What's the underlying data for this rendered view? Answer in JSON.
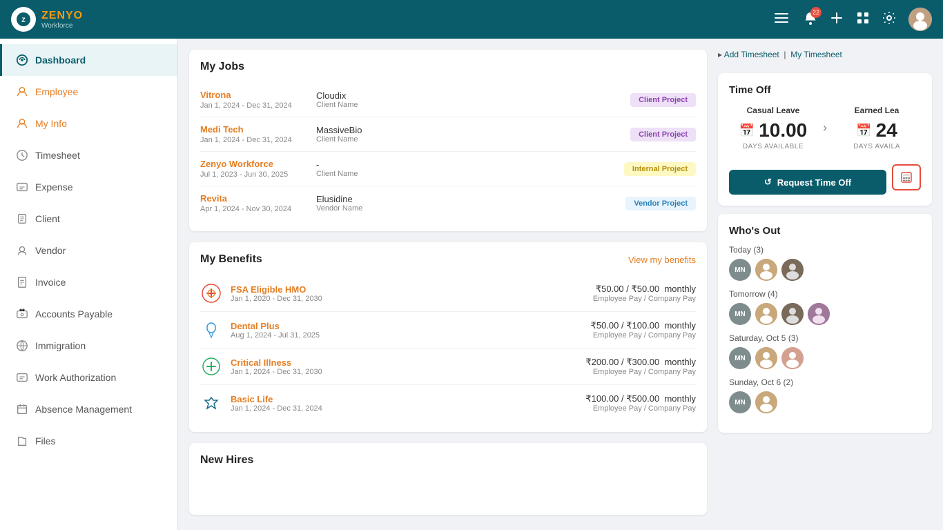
{
  "header": {
    "logo_text": "ZENYO",
    "logo_sub": "Workforce",
    "notification_count": "22",
    "actions": [
      "notification",
      "add",
      "apps",
      "settings",
      "avatar"
    ]
  },
  "sidebar": {
    "items": [
      {
        "id": "dashboard",
        "label": "Dashboard",
        "active": true
      },
      {
        "id": "employee",
        "label": "Employee",
        "active": false,
        "orange": true
      },
      {
        "id": "myinfo",
        "label": "My Info",
        "active": false,
        "orange": true
      },
      {
        "id": "timesheet",
        "label": "Timesheet",
        "active": false
      },
      {
        "id": "expense",
        "label": "Expense",
        "active": false
      },
      {
        "id": "client",
        "label": "Client",
        "active": false
      },
      {
        "id": "vendor",
        "label": "Vendor",
        "active": false
      },
      {
        "id": "invoice",
        "label": "Invoice",
        "active": false
      },
      {
        "id": "accounts-payable",
        "label": "Accounts Payable",
        "active": false
      },
      {
        "id": "immigration",
        "label": "Immigration",
        "active": false
      },
      {
        "id": "work-authorization",
        "label": "Work Authorization",
        "active": false
      },
      {
        "id": "absence-management",
        "label": "Absence Management",
        "active": false
      },
      {
        "id": "files",
        "label": "Files",
        "active": false
      }
    ]
  },
  "my_jobs": {
    "title": "My Jobs",
    "rows": [
      {
        "name": "Vitrona",
        "dates": "Jan 1, 2024 - Dec 31, 2024",
        "client": "Cloudix",
        "client_label": "Client Name",
        "badge": "Client Project",
        "badge_type": "client"
      },
      {
        "name": "Medi Tech",
        "dates": "Jan 1, 2024 - Dec 31, 2024",
        "client": "MassiveBio",
        "client_label": "Client Name",
        "badge": "Client Project",
        "badge_type": "client"
      },
      {
        "name": "Zenyo Workforce",
        "dates": "Jul 1, 2023 - Jun 30, 2025",
        "client": "-",
        "client_label": "Client Name",
        "badge": "Internal Project",
        "badge_type": "internal"
      },
      {
        "name": "Revita",
        "dates": "Apr 1, 2024 - Nov 30, 2024",
        "client": "Elusidine",
        "client_label": "Vendor Name",
        "badge": "Vendor Project",
        "badge_type": "vendor"
      }
    ]
  },
  "my_benefits": {
    "title": "My Benefits",
    "view_link": "View my benefits",
    "rows": [
      {
        "name": "FSA Eligible HMO",
        "dates": "Jan 1, 2020 - Dec 31, 2030",
        "amount": "₹50.00 / ₹50.00  monthly",
        "pay_label": "Employee Pay / Company Pay",
        "icon": "❤️"
      },
      {
        "name": "Dental Plus",
        "dates": "Aug 1, 2024 - Jul 31, 2025",
        "amount": "₹50.00 / ₹100.00  monthly",
        "pay_label": "Employee Pay / Company Pay",
        "icon": "🦷"
      },
      {
        "name": "Critical Illness",
        "dates": "Jan 1, 2024 - Dec 31, 2030",
        "amount": "₹200.00 / ₹300.00  monthly",
        "pay_label": "Employee Pay / Company Pay",
        "icon": "💚"
      },
      {
        "name": "Basic Life",
        "dates": "Jan 1, 2024 - Dec 31, 2024",
        "amount": "₹100.00 / ₹500.00  monthly",
        "pay_label": "Employee Pay / Company Pay",
        "icon": "🛡️"
      }
    ]
  },
  "new_hires": {
    "title": "New Hires"
  },
  "timesheet_links": {
    "add": "Add Timesheet",
    "my": "My Timesheet",
    "separator": "|"
  },
  "time_off": {
    "title": "Time Off",
    "leaves": [
      {
        "label": "Casual Leave",
        "days": "10.00",
        "sub": "DAYS AVAILABLE"
      },
      {
        "label": "Earned Lea",
        "days": "24",
        "sub": "DAYS AVAILA"
      }
    ],
    "request_btn": "Request Time Off"
  },
  "whos_out": {
    "title": "Who's Out",
    "days": [
      {
        "label": "Today (3)",
        "avatars": [
          "MN",
          "F1",
          "M1"
        ]
      },
      {
        "label": "Tomorrow (4)",
        "avatars": [
          "MN",
          "F2",
          "M2",
          "F3"
        ]
      },
      {
        "label": "Saturday, Oct 5 (3)",
        "avatars": [
          "MN",
          "F4",
          "F5"
        ]
      },
      {
        "label": "Sunday, Oct 6 (2)",
        "avatars": [
          "MN",
          "F6"
        ]
      }
    ]
  }
}
